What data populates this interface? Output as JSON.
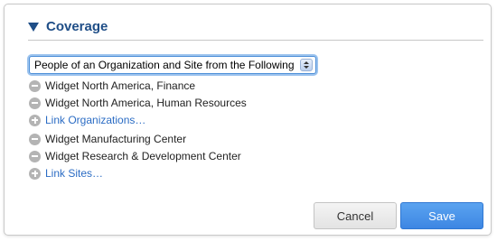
{
  "coverage": {
    "title": "Coverage",
    "scope_select": {
      "value": "People of an Organization and Site from the Following"
    },
    "organizations": [
      {
        "label": "Widget North America, Finance"
      },
      {
        "label": "Widget North America, Human Resources"
      }
    ],
    "link_organizations_label": "Link Organizations…",
    "sites": [
      {
        "label": "Widget Manufacturing Center"
      },
      {
        "label": "Widget Research & Development Center"
      }
    ],
    "link_sites_label": "Link Sites…"
  },
  "actions": {
    "cancel_label": "Cancel",
    "save_label": "Save"
  },
  "colors": {
    "accent": "#1f4e87",
    "link": "#2b6cc4",
    "primary_button": "#3d86e3"
  },
  "icons": {
    "collapse": "triangle-down-icon",
    "remove": "minus-circle-icon",
    "add": "plus-circle-icon",
    "stepper": "up-down-stepper-icon"
  }
}
